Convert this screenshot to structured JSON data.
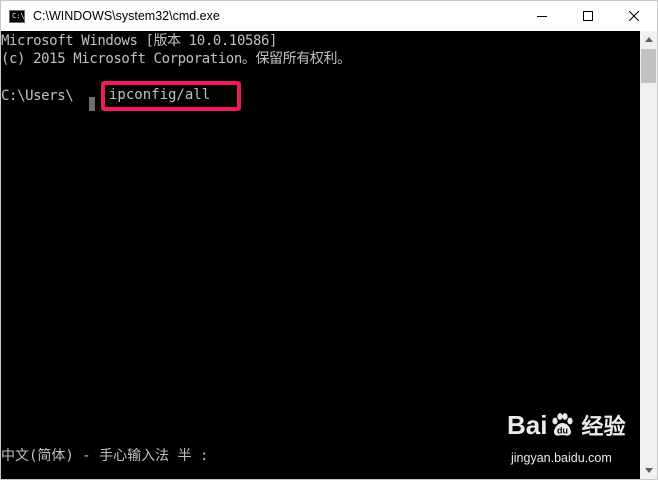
{
  "window": {
    "title": "C:\\WINDOWS\\system32\\cmd.exe",
    "icon_label": "C:\\",
    "controls": {
      "minimize": "minimize-icon",
      "maximize": "maximize-icon",
      "close": "close-icon"
    }
  },
  "console": {
    "lines": [
      "Microsoft Windows [版本 10.0.10586]",
      "(c) 2015 Microsoft Corporation。保留所有权利。",
      "",
      "C:\\Users\\"
    ],
    "command": "ipconfig/all",
    "ime_status": "中文(简体) - 手心输入法 半 :"
  },
  "annotation": {
    "color": "#f0195a"
  },
  "watermark": {
    "brand_left": "Bai",
    "brand_right": "经验",
    "url": "jingyan.baidu.com"
  },
  "colors": {
    "console_bg": "#000000",
    "console_text": "#c0c0c0",
    "titlebar_bg": "#ffffff"
  }
}
